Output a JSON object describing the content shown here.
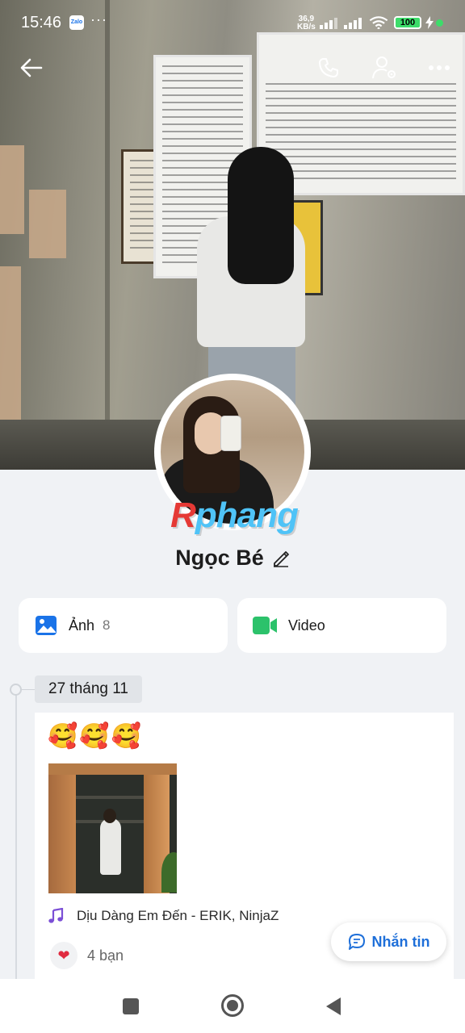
{
  "status_bar": {
    "time": "15:46",
    "app_badge": "Zalo",
    "more": "···",
    "net_speed_value": "36,9",
    "net_speed_unit": "KB/s",
    "battery": "100"
  },
  "profile": {
    "name": "Ngọc Bé",
    "watermark_r": "R",
    "watermark_rest": "phang"
  },
  "media": {
    "photos_label": "Ảnh",
    "photos_count": "8",
    "video_label": "Video"
  },
  "timeline": {
    "date": "27 tháng 11",
    "post": {
      "emoji": "🥰🥰🥰",
      "music": "Dịu Dàng Em Đến - ERIK, NinjaZ",
      "likes": "4 bạn"
    }
  },
  "message_button": "Nhắn tin",
  "colors": {
    "accent_blue": "#1e6fd9",
    "video_green": "#2cc26b",
    "photo_blue": "#1a73e8",
    "heart_red": "#e02a3f"
  }
}
